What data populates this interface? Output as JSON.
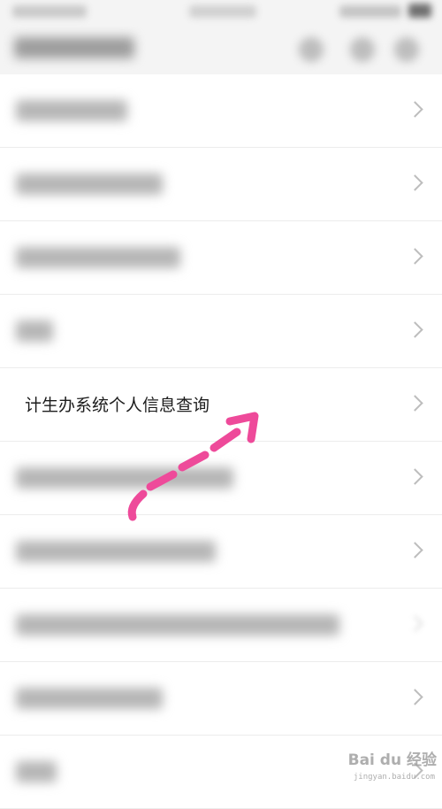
{
  "list": {
    "highlighted_item": {
      "label": "计生办系统个人信息查询"
    }
  },
  "icons": {
    "chevron": "chevron-right-icon",
    "arrow": "pink-dashed-arrow"
  },
  "colors": {
    "arrow": "#ee4a9a",
    "row_background": "#ffffff",
    "page_background": "#f4f4f4"
  },
  "watermark": {
    "brand": "Bai du 经验",
    "sub": "jingyan.baidu.com"
  }
}
